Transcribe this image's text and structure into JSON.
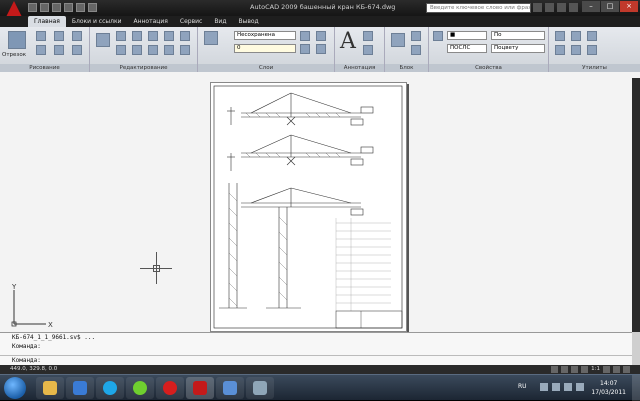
{
  "window": {
    "title": "AutoCAD 2009 башенный кран КБ-674.dwg",
    "search_placeholder": "Введите ключевое слово или фразу"
  },
  "ribbon_tabs": [
    "Главная",
    "Блоки и ссылки",
    "Аннотация",
    "Сервис",
    "Вид",
    "Вывод"
  ],
  "ribbon": {
    "panels": [
      "Рисование",
      "Редактирование",
      "Слои",
      "Аннотация",
      "Блок",
      "Свойства",
      "Утилиты"
    ],
    "otrezok_label": "Отрезок",
    "layer_state": "Несохранена",
    "layer_current": "0",
    "linetype": "ПОСЛС",
    "lineweight": "По",
    "plotstyle": "Поцвету"
  },
  "ucs": {
    "x_label": "X",
    "y_label": "Y"
  },
  "command": {
    "line1": "КБ-674_1_1_9661.sv$ ...",
    "line2": "Команда:",
    "prompt": "Команда:"
  },
  "status": {
    "coords": "449.0, 329.8, 0.0",
    "scale": "1:1"
  },
  "taskbar": {
    "lang": "RU",
    "time": "14:07",
    "date": "17/03/2011"
  }
}
